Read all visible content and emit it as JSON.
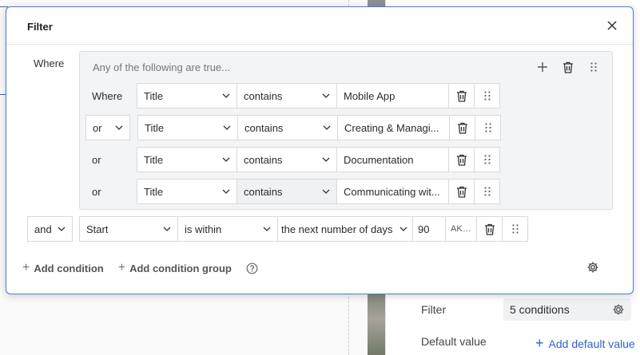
{
  "dialog": {
    "title": "Filter",
    "where_label": "Where",
    "group": {
      "header": "Any of the following are true...",
      "rows": [
        {
          "connector": "Where",
          "connector_is_select": false,
          "field": "Title",
          "operator": "contains",
          "value": "Mobile App"
        },
        {
          "connector": "or",
          "connector_is_select": true,
          "field": "Title",
          "operator": "contains",
          "value": "Creating & Managi..."
        },
        {
          "connector": "or",
          "connector_is_select": false,
          "field": "Title",
          "operator": "contains",
          "value": "Documentation"
        },
        {
          "connector": "or",
          "connector_is_select": false,
          "field": "Title",
          "operator": "contains",
          "value": "Communicating wit..."
        }
      ]
    },
    "outer_row": {
      "connector": "and",
      "field": "Start",
      "operator": "is within",
      "range": "the next number of days",
      "value": "90",
      "timezone": "AKDT"
    },
    "footer": {
      "add_condition": "Add condition",
      "add_condition_group": "Add condition group"
    }
  },
  "side_panel": {
    "filter_label": "Filter",
    "filter_value": "5 conditions",
    "default_value_label": "Default value",
    "add_default_value": "Add default value"
  },
  "colors": {
    "accent": "#4a7fd4",
    "link": "#2f62c8"
  }
}
